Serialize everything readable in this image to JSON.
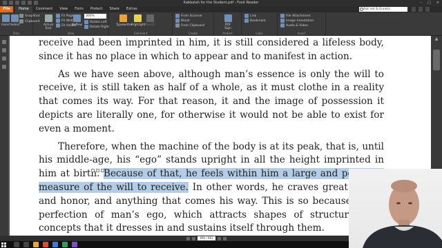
{
  "window": {
    "title": "Kabbalah for the Student.pdf - Foxit Reader"
  },
  "menu": {
    "file_label": "File",
    "tabs": [
      "Home",
      "Comment",
      "View",
      "Form",
      "Protect",
      "Share",
      "Extras"
    ],
    "search_placeholder": "Ask not & Eureka",
    "colors": {
      "file_tab": "#e86a17"
    }
  },
  "ribbon": {
    "hand_label": "Hand",
    "select_label": "Select",
    "snapshot_label": "SnapShot",
    "clipboard_label": "Clipboard",
    "actual_size_label": "Actual Size",
    "fit_page_label": "Fit Page",
    "fit_width_label": "Fit Width",
    "fit_visible_label": "Fit Visible",
    "reflow_label": "Reflow",
    "zoom_value": "300%",
    "rotate_left_label": "Rotate Left",
    "rotate_right_label": "Rotate Right",
    "typewriter_label": "Typewriter",
    "highlight_label": "Highlight",
    "pencil_label": "Pencil",
    "from_scanner_label": "From Scanner",
    "blank_label": "Blank",
    "from_clipboard_label": "From Clipboard",
    "pdf_sign_label": "PDF Sign",
    "link_label": "Link",
    "bookmark_label": "Bookmark",
    "file_attachment_label": "File Attachment",
    "image_annotation_label": "Image Annotation",
    "audio_video_label": "Audio & Video",
    "groups": [
      "Tools",
      "View",
      "Comment",
      "Create",
      "Protect",
      "Links",
      "Insert"
    ]
  },
  "document": {
    "para1": "receive had been imprinted in him, it is still considered a lifeless body, since it has no place in which to appear and to manifest in action.",
    "para2": "As we have seen above, although man’s essence is only the will to receive, it is still taken as half of a whole, as it must clothe in a reality that comes its way. For that reason, it and the image of possession it depicts are literally one, for otherwise it would not be able to exist for even a moment.",
    "para3_before": "Therefore, when the machine of the body is at its peak, that is, until his middle-age, his “ego” stands upright in all the height imprinted in him at birth. ",
    "para3_highlight": "Because of that, he feels within him a large and powerful measure of the will to receive.",
    "para3_after": " In other words, he craves great wealth and honor, and anything that comes his way. This is so because of the perfection of man’s ego, which attracts shapes of structures and concepts that it dresses in and sustains itself through them.",
    "highlight_color": "#b3cde6"
  },
  "statusbar": {
    "page_indicator": "896 / 961"
  }
}
